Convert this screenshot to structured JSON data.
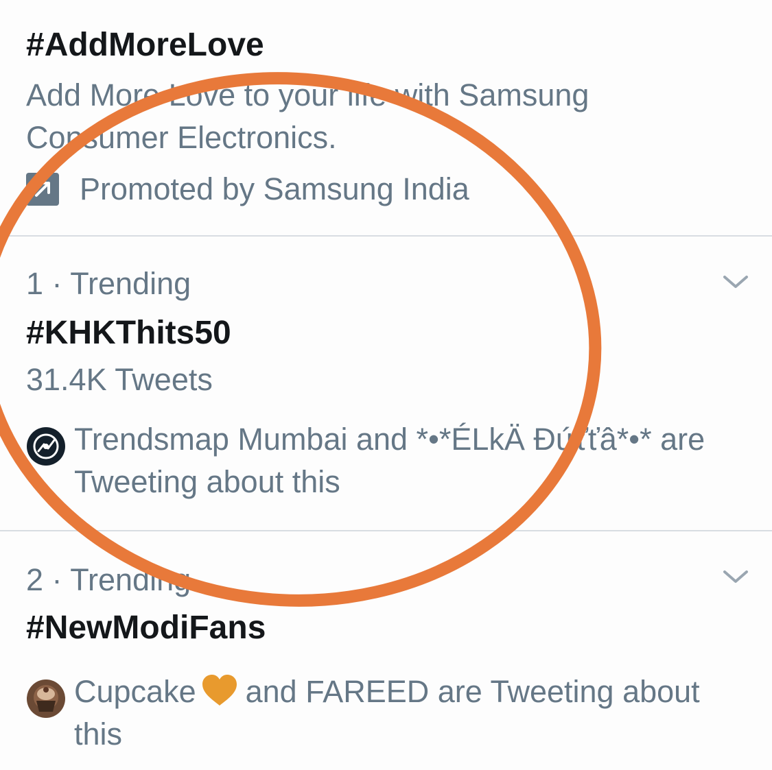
{
  "colors": {
    "text_primary": "#14171a",
    "text_secondary": "#657786",
    "divider": "#d8dde2",
    "annotation": "#e8793a"
  },
  "promoted": {
    "hashtag": "#AddMoreLove",
    "description": "Add More Love to your life with Samsung Consumer Electronics.",
    "promoted_by": "Promoted by Samsung India",
    "icon": "promoted-arrow-icon"
  },
  "trends": [
    {
      "meta": "1 · Trending",
      "hashtag": "#KHKThits50",
      "count": "31.4K Tweets",
      "social_text": "Trendsmap Mumbai and *•*ÉLkÄ Ðứťťâ*•* are Tweeting about this",
      "avatar_icon": "trendsmap-avatar-icon"
    },
    {
      "meta": "2 · Trending",
      "hashtag": "#NewModiFans",
      "social_before": "Cupcake",
      "social_after": "and FAREED are Tweeting about this",
      "avatar_icon": "cupcake-avatar-icon",
      "emoji_icon": "orange-heart-icon"
    }
  ]
}
